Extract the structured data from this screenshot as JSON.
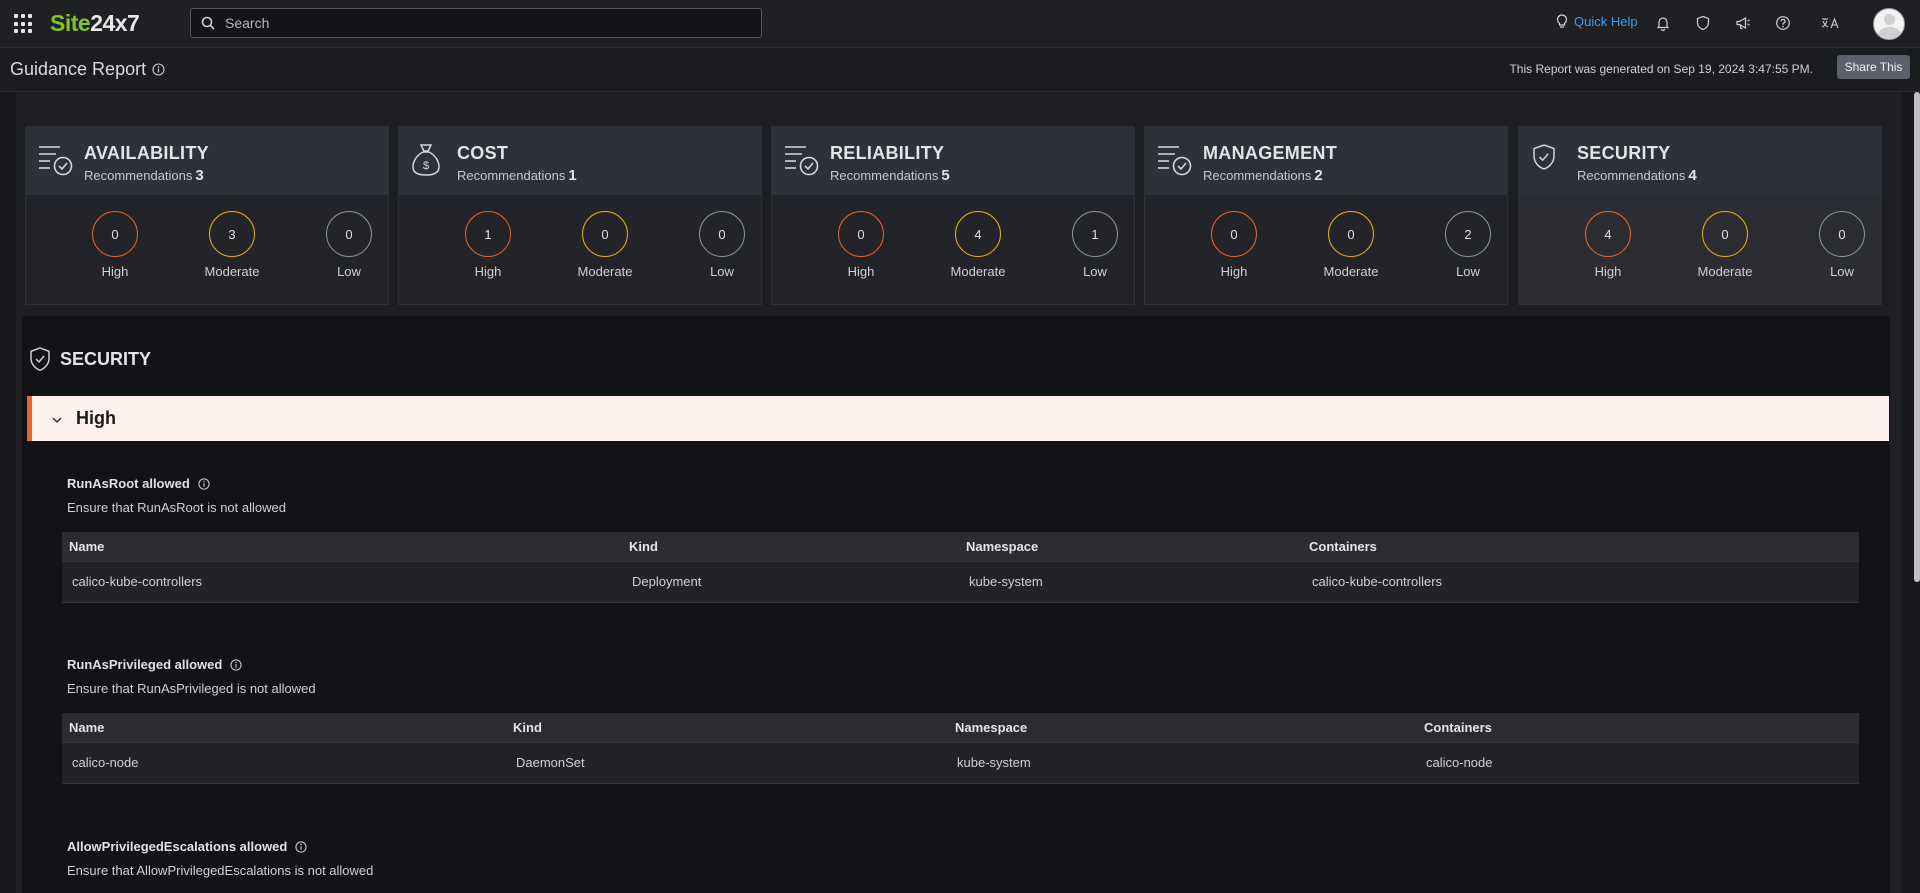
{
  "topbar": {
    "logo_site": "Site",
    "logo_rest": "24x7",
    "search_placeholder": "Search",
    "quick_help": "Quick Help",
    "icons": [
      "bell-icon",
      "shield-icon",
      "megaphone-icon",
      "help-icon",
      "language-icon"
    ]
  },
  "header": {
    "title": "Guidance Report",
    "generated": "This Report was generated on Sep 19, 2024 3:47:55 PM.",
    "share_label": "Share This"
  },
  "labels": {
    "recommendations": "Recommendations",
    "high": "High",
    "moderate": "Moderate",
    "low": "Low"
  },
  "categories": [
    {
      "name": "AVAILABILITY",
      "count": "3",
      "high": "0",
      "moderate": "3",
      "low": "0",
      "icon": "checklist-icon"
    },
    {
      "name": "COST",
      "count": "1",
      "high": "1",
      "moderate": "0",
      "low": "0",
      "icon": "money-bag-icon"
    },
    {
      "name": "RELIABILITY",
      "count": "5",
      "high": "0",
      "moderate": "4",
      "low": "1",
      "icon": "checklist-icon"
    },
    {
      "name": "MANAGEMENT",
      "count": "2",
      "high": "0",
      "moderate": "0",
      "low": "2",
      "icon": "checklist-icon"
    },
    {
      "name": "SECURITY",
      "count": "4",
      "high": "4",
      "moderate": "0",
      "low": "0",
      "icon": "shield-check-icon"
    }
  ],
  "section": {
    "title": "SECURITY",
    "group": "High",
    "rules": [
      {
        "title": "RunAsRoot allowed",
        "desc": "Ensure that RunAsRoot is not allowed",
        "columns": [
          "Name",
          "Kind",
          "Namespace",
          "Containers"
        ],
        "rows": [
          [
            "calico-kube-controllers",
            "Deployment",
            "kube-system",
            "calico-kube-controllers"
          ]
        ]
      },
      {
        "title": "RunAsPrivileged allowed",
        "desc": "Ensure that RunAsPrivileged is not allowed",
        "columns": [
          "Name",
          "Kind",
          "Namespace",
          "Containers"
        ],
        "rows": [
          [
            "calico-node",
            "DaemonSet",
            "kube-system",
            "calico-node"
          ]
        ]
      },
      {
        "title": "AllowPrivilegedEscalations allowed",
        "desc": "Ensure that AllowPrivilegedEscalations is not allowed"
      }
    ]
  },
  "colors": {
    "high": "#e8662a",
    "moderate": "#e9ab17",
    "low": "#8e9199",
    "brand": "#7fc42b",
    "link": "#3b9cf0"
  }
}
